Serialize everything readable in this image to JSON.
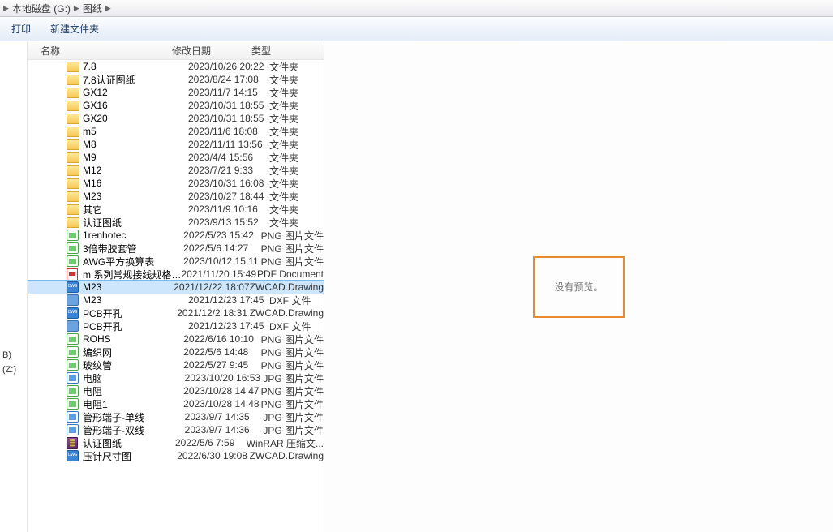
{
  "breadcrumb": {
    "disk": "本地磁盘 (G:)",
    "folder": "图纸"
  },
  "toolbar": {
    "print": "打印",
    "new_folder": "新建文件夹"
  },
  "columns": {
    "name": "名称",
    "date": "修改日期",
    "type": "类型"
  },
  "sidebar": {
    "drive_b": "B)",
    "drive_z": "(Z:)"
  },
  "preview": {
    "no_preview": "没有预览。"
  },
  "selected_index": 17,
  "files": [
    {
      "name": "7.8",
      "date": "2023/10/26 20:22",
      "type": "文件夹",
      "icon": "folder"
    },
    {
      "name": "7.8认证图纸",
      "date": "2023/8/24 17:08",
      "type": "文件夹",
      "icon": "folder"
    },
    {
      "name": "GX12",
      "date": "2023/11/7 14:15",
      "type": "文件夹",
      "icon": "folder"
    },
    {
      "name": "GX16",
      "date": "2023/10/31 18:55",
      "type": "文件夹",
      "icon": "folder"
    },
    {
      "name": "GX20",
      "date": "2023/10/31 18:55",
      "type": "文件夹",
      "icon": "folder"
    },
    {
      "name": "m5",
      "date": "2023/11/6 18:08",
      "type": "文件夹",
      "icon": "folder"
    },
    {
      "name": "M8",
      "date": "2022/11/11 13:56",
      "type": "文件夹",
      "icon": "folder"
    },
    {
      "name": "M9",
      "date": "2023/4/4 15:56",
      "type": "文件夹",
      "icon": "folder"
    },
    {
      "name": "M12",
      "date": "2023/7/21 9:33",
      "type": "文件夹",
      "icon": "folder"
    },
    {
      "name": "M16",
      "date": "2023/10/31 16:08",
      "type": "文件夹",
      "icon": "folder"
    },
    {
      "name": "M23",
      "date": "2023/10/27 18:44",
      "type": "文件夹",
      "icon": "folder"
    },
    {
      "name": "其它",
      "date": "2023/11/9 10:16",
      "type": "文件夹",
      "icon": "folder"
    },
    {
      "name": "认证图纸",
      "date": "2023/9/13 15:52",
      "type": "文件夹",
      "icon": "folder"
    },
    {
      "name": "1renhotec",
      "date": "2022/5/23 15:42",
      "type": "PNG 图片文件",
      "icon": "png"
    },
    {
      "name": "3倍带胶套管",
      "date": "2022/5/6 14:27",
      "type": "PNG 图片文件",
      "icon": "png"
    },
    {
      "name": "AWG平方换算表",
      "date": "2023/10/12 15:11",
      "type": "PNG 图片文件",
      "icon": "png"
    },
    {
      "name": "m 系列常规接线规格_（修订版）",
      "date": "2021/11/20 15:49",
      "type": "PDF Document",
      "icon": "pdf"
    },
    {
      "name": "M23",
      "date": "2021/12/22 18:07",
      "type": "ZWCAD.Drawing",
      "icon": "zwcad"
    },
    {
      "name": "M23",
      "date": "2021/12/23 17:45",
      "type": "DXF 文件",
      "icon": "dxf"
    },
    {
      "name": "PCB开孔",
      "date": "2021/12/2 18:31",
      "type": "ZWCAD.Drawing",
      "icon": "zwcad"
    },
    {
      "name": "PCB开孔",
      "date": "2021/12/23 17:45",
      "type": "DXF 文件",
      "icon": "dxf"
    },
    {
      "name": "ROHS",
      "date": "2022/6/16 10:10",
      "type": "PNG 图片文件",
      "icon": "png"
    },
    {
      "name": "编织网",
      "date": "2022/5/6 14:48",
      "type": "PNG 图片文件",
      "icon": "png"
    },
    {
      "name": "玻纹管",
      "date": "2022/5/27 9:45",
      "type": "PNG 图片文件",
      "icon": "png"
    },
    {
      "name": "电脑",
      "date": "2023/10/20 16:53",
      "type": "JPG 图片文件",
      "icon": "jpg"
    },
    {
      "name": "电阻",
      "date": "2023/10/28 14:47",
      "type": "PNG 图片文件",
      "icon": "png"
    },
    {
      "name": "电阻1",
      "date": "2023/10/28 14:48",
      "type": "PNG 图片文件",
      "icon": "png"
    },
    {
      "name": "管形端子-单线",
      "date": "2023/9/7 14:35",
      "type": "JPG 图片文件",
      "icon": "jpg"
    },
    {
      "name": "管形端子-双线",
      "date": "2023/9/7 14:36",
      "type": "JPG 图片文件",
      "icon": "jpg"
    },
    {
      "name": "认证图纸",
      "date": "2022/5/6 7:59",
      "type": "WinRAR 压缩文...",
      "icon": "rar"
    },
    {
      "name": "压针尺寸图",
      "date": "2022/6/30 19:08",
      "type": "ZWCAD.Drawing",
      "icon": "zwcad"
    }
  ]
}
